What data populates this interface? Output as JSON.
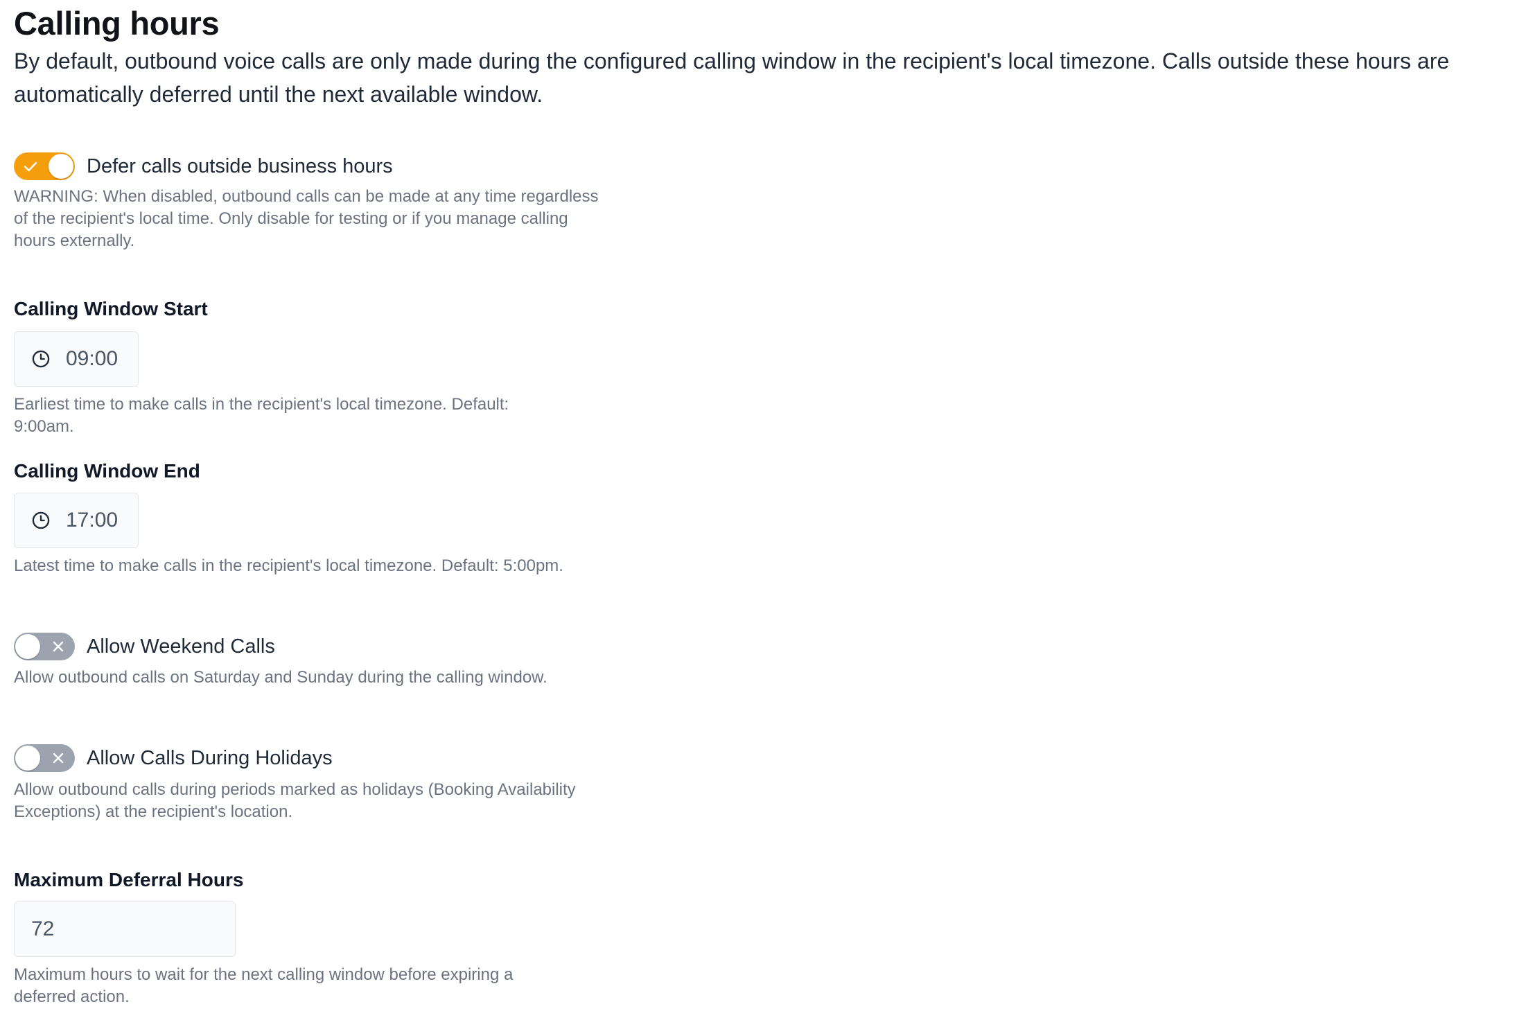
{
  "header": {
    "title": "Calling hours",
    "description": "By default, outbound voice calls are only made during the configured calling window in the recipient's local timezone. Calls outside these hours are automatically deferred until the next available window."
  },
  "defer_toggle": {
    "label": "Defer calls outside business hours",
    "checked": true,
    "help": "WARNING: When disabled, outbound calls can be made at any time regardless of the recipient's local time. Only disable for testing or if you manage calling hours externally."
  },
  "window_start": {
    "label": "Calling Window Start",
    "value": "09:00",
    "help": "Earliest time to make calls in the recipient's local timezone. Default: 9:00am.",
    "icon": "clock-icon"
  },
  "window_end": {
    "label": "Calling Window End",
    "value": "17:00",
    "help": "Latest time to make calls in the recipient's local timezone. Default: 5:00pm.",
    "icon": "clock-icon"
  },
  "weekend_toggle": {
    "label": "Allow Weekend Calls",
    "checked": false,
    "help": "Allow outbound calls on Saturday and Sunday during the calling window."
  },
  "holiday_toggle": {
    "label": "Allow Calls During Holidays",
    "checked": false,
    "help": "Allow outbound calls during periods marked as holidays (Booking Availability Exceptions) at the recipient's location."
  },
  "max_deferral": {
    "label": "Maximum Deferral Hours",
    "value": "72",
    "help": "Maximum hours to wait for the next calling window before expiring a deferred action."
  },
  "colors": {
    "accent": "#f59e0b",
    "toggle_off": "#9ca3af",
    "help_text": "#6b7280"
  }
}
